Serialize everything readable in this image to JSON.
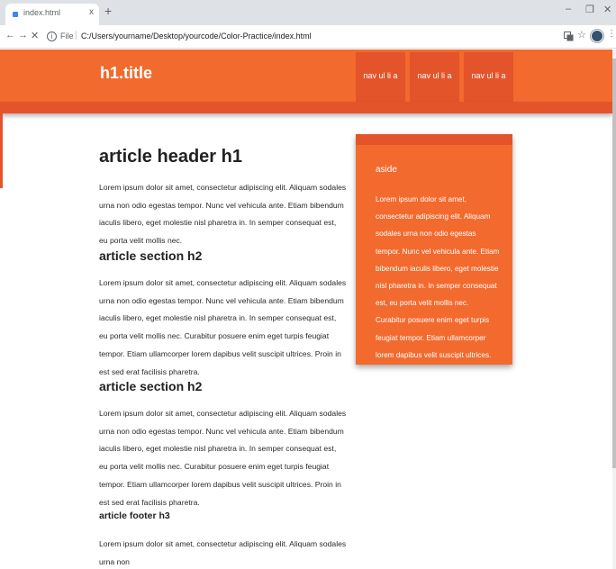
{
  "browser": {
    "tab_title": "index.html",
    "new_tab_glyph": "+",
    "tab_close_glyph": "x",
    "window_controls": [
      "–",
      "❐",
      "✕"
    ],
    "scheme_label": "File",
    "url": "C:/Users/yourname/Desktop/yourcode/Color-Practice/index.html",
    "nav_glyphs": {
      "back": "←",
      "forward": "→",
      "reload": "✕"
    },
    "toolbar_icons": [
      "translate-icon",
      "star-icon",
      "profile-icon",
      "menu-icon"
    ]
  },
  "site": {
    "title": "h1.title",
    "nav": [
      "nav ul li a",
      "nav ul li a",
      "nav ul li a"
    ],
    "colors": {
      "primary": "#f26a2e",
      "dark": "#e4542b",
      "text": "#222222"
    }
  },
  "article": {
    "header": "article header h1",
    "intro": "Lorem ipsum dolor sit amet, consectetur adipiscing elit. Aliquam sodales urna non odio egestas tempor. Nunc vel vehicula ante. Etiam bibendum iaculis libero, eget molestie nisl pharetra in. In semper consequat est, eu porta velit mollis nec.",
    "section1_title": "article section h2",
    "section1_text": "Lorem ipsum dolor sit amet, consectetur adipiscing elit. Aliquam sodales urna non odio egestas tempor. Nunc vel vehicula ante. Etiam bibendum iaculis libero, eget molestie nisl pharetra in. In semper consequat est, eu porta velit mollis nec. Curabitur posuere enim eget turpis feugiat tempor. Etiam ullamcorper lorem dapibus velit suscipit ultrices. Proin in est sed erat facilisis pharetra.",
    "section2_title": "article section h2",
    "section2_text": "Lorem ipsum dolor sit amet, consectetur adipiscing elit. Aliquam sodales urna non odio egestas tempor. Nunc vel vehicula ante. Etiam bibendum iaculis libero, eget molestie nisl pharetra in. In semper consequat est, eu porta velit mollis nec. Curabitur posuere enim eget turpis feugiat tempor. Etiam ullamcorper lorem dapibus velit suscipit ultrices. Proin in est sed erat facilisis pharetra.",
    "footer_title": "article footer h3",
    "footer_text": "Lorem ipsum dolor sit amet, consectetur adipiscing elit. Aliquam sodales urna non"
  },
  "aside": {
    "title": "aside",
    "text": "Lorem ipsum dolor sit amet, consectetur adipiscing elit. Aliquam sodales urna non odio egestas tempor. Nunc vel vehicula ante. Etiam bibendum iaculis libero, eget molestie nisl pharetra in. In semper consequat est, eu porta velit mollis nec. Curabitur posuere enim eget turpis feugiat tempor. Etiam ullamcorper lorem dapibus velit suscipit ultrices."
  }
}
